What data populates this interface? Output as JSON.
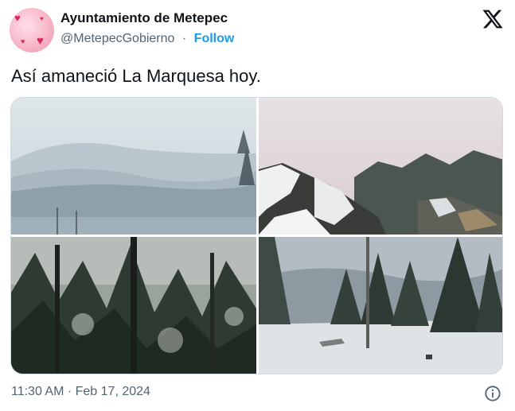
{
  "author": {
    "display_name": "Ayuntamiento de Metepec",
    "handle": "@MetepecGobierno",
    "separator": "·",
    "follow_label": "Follow"
  },
  "tweet": {
    "text": "Así amaneció La Marquesa hoy."
  },
  "media": {
    "photo_count": 4,
    "photos": [
      {
        "subject": "snowy forested hills under fog"
      },
      {
        "subject": "snow-covered rocks in fog"
      },
      {
        "subject": "snow on dark pine forest"
      },
      {
        "subject": "snowy clearing with pine trees"
      }
    ]
  },
  "footer": {
    "timestamp": "11:30 AM · Feb 17, 2024"
  },
  "icons": {
    "platform_logo": "x-logo-icon",
    "info": "info-icon"
  },
  "colors": {
    "text_primary": "#0f1419",
    "text_secondary": "#536471",
    "accent": "#1d9bf0",
    "border": "#cfd9de"
  }
}
